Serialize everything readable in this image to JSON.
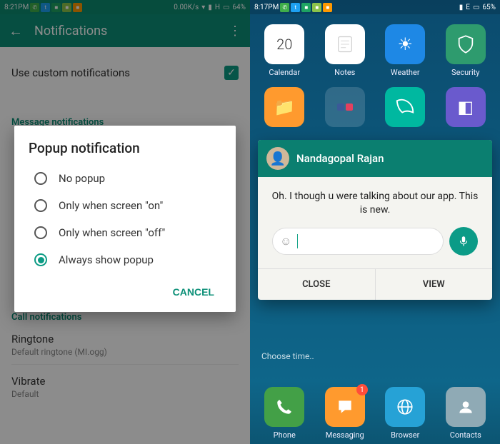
{
  "left": {
    "status": {
      "time": "8:21PM",
      "speed": "0.00K/s",
      "net": "H",
      "battery": "64%"
    },
    "appbar": {
      "title": "Notifications"
    },
    "settings": {
      "use_custom": "Use custom notifications",
      "msg_header": "Message notifications",
      "call_header": "Call notifications",
      "ringtone_label": "Ringtone",
      "ringtone_value": "Default ringtone (MI.ogg)",
      "vibrate_label": "Vibrate",
      "vibrate_value": "Default"
    },
    "dialog": {
      "title": "Popup notification",
      "options": [
        "No popup",
        "Only when screen \"on\"",
        "Only when screen \"off\"",
        "Always show popup"
      ],
      "selected_index": 3,
      "cancel": "CANCEL"
    }
  },
  "right": {
    "status": {
      "time": "8:17PM",
      "net": "E",
      "battery": "65%"
    },
    "apps_row1": [
      "Calendar",
      "Notes",
      "Weather",
      "Security"
    ],
    "calendar_day": "20",
    "choose_time": "Choose time..",
    "dock": [
      "Phone",
      "Messaging",
      "Browser",
      "Contacts"
    ],
    "messaging_badge": "1",
    "popup": {
      "name": "Nandagopal Rajan",
      "message": "Oh. I though u were talking about our app. This is new.",
      "close": "CLOSE",
      "view": "VIEW"
    }
  }
}
